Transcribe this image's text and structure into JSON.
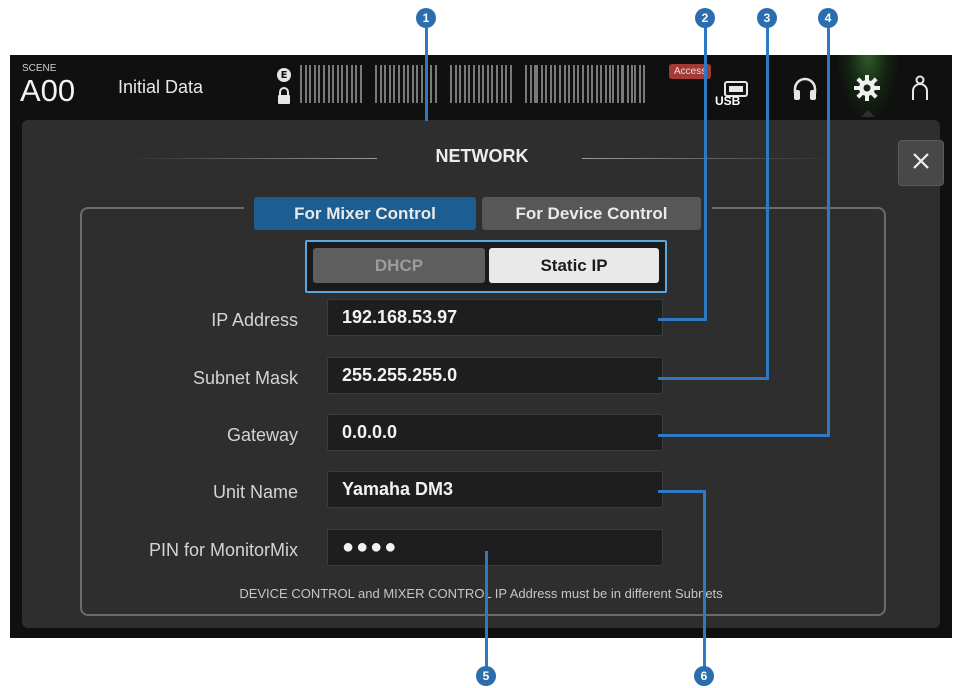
{
  "callouts": [
    "1",
    "2",
    "3",
    "4",
    "5",
    "6"
  ],
  "topbar": {
    "scene_label": "SCENE",
    "scene_number": "A00",
    "scene_title": "Initial Data",
    "e_badge": "E",
    "access_badge": "Access",
    "usb_label": "USB",
    "icons": [
      "lock-icon",
      "usb-icon",
      "headphones-icon",
      "gear-icon",
      "user-icon"
    ]
  },
  "dialog": {
    "title": "NETWORK",
    "close_label": "×",
    "tabs": [
      {
        "label": "For Mixer Control",
        "selected": true
      },
      {
        "label": "For Device Control",
        "selected": false
      }
    ],
    "mode": {
      "options": [
        "DHCP",
        "Static IP"
      ],
      "selected": "Static IP"
    },
    "fields": {
      "ip_address": {
        "label": "IP Address",
        "value": "192.168.53.97"
      },
      "subnet_mask": {
        "label": "Subnet Mask",
        "value": "255.255.255.0"
      },
      "gateway": {
        "label": "Gateway",
        "value": "0.0.0.0"
      },
      "unit_name": {
        "label": "Unit Name",
        "value": "Yamaha DM3"
      },
      "pin": {
        "label": "PIN for MonitorMix",
        "value": "●●●●"
      }
    },
    "note": "DEVICE CONTROL and MIXER CONTROL IP Address must be in different Subnets"
  },
  "colors": {
    "accent_blue": "#1d5e92",
    "callout_blue": "#2c6dae",
    "panel_bg": "#2e2e2e",
    "access_red": "#a33a33"
  }
}
